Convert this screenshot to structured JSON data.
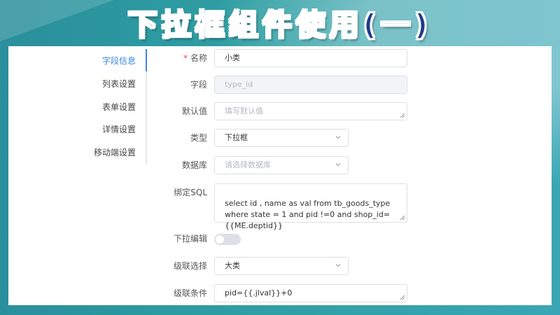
{
  "banner": {
    "title": "下拉框组件使用(一)"
  },
  "sidebar": {
    "items": [
      {
        "label": "字段信息",
        "active": true
      },
      {
        "label": "列表设置",
        "active": false
      },
      {
        "label": "表单设置",
        "active": false
      },
      {
        "label": "详情设置",
        "active": false
      },
      {
        "label": "移动端设置",
        "active": false
      }
    ]
  },
  "form": {
    "name": {
      "label": "名称",
      "required_mark": "*",
      "value": "小类"
    },
    "field": {
      "label": "字段",
      "placeholder": "type_id"
    },
    "default": {
      "label": "默认值",
      "placeholder": "填写默认值"
    },
    "type": {
      "label": "类型",
      "value": "下拉框"
    },
    "database": {
      "label": "数据库",
      "placeholder": "请选择数据库"
    },
    "bind_sql": {
      "label": "绑定SQL",
      "value": "select id , name as val from tb_goods_type\nwhere state = 1 and pid !=0 and shop_id=\n{{ME.deptid}}"
    },
    "dropdown_edit": {
      "label": "下拉编辑",
      "enabled": false
    },
    "cascade_select": {
      "label": "级联选择",
      "value": "大类"
    },
    "cascade_condition": {
      "label": "级联条件",
      "value": "pid={{.jlval}}+0"
    }
  },
  "colors": {
    "accent": "#3a86e0",
    "required": "#e5484d",
    "banner_text": "#1f3a8a"
  }
}
